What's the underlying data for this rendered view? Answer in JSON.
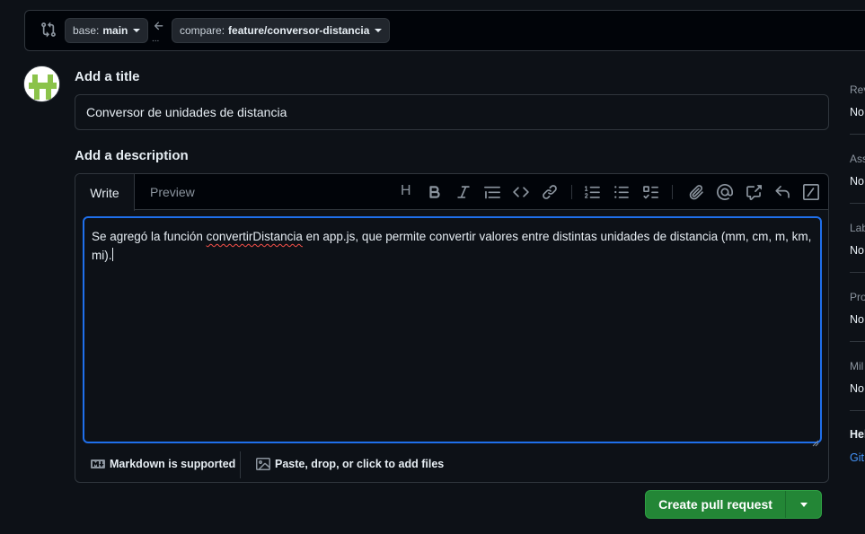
{
  "compare": {
    "base_label": "base:",
    "base_value": "main",
    "compare_label": "compare:",
    "compare_value": "feature/conversor-distancia",
    "arrow_dots": "..."
  },
  "form": {
    "title_label": "Add a title",
    "title_value": "Conversor de unidades de distancia",
    "description_label": "Add a description"
  },
  "editor": {
    "tabs": [
      "Write",
      "Preview"
    ],
    "heading_glyph": "H",
    "text_before": "Se agregó la función ",
    "text_misspelled": "convertirDistancia",
    "text_after": " en app.js, que permite convertir valores entre distintas unidades de distancia (mm, cm, m, km, mi).",
    "markdown_note": "Markdown is supported",
    "attach_note": "Paste, drop, or click to add files"
  },
  "actions": {
    "create_label": "Create pull request"
  },
  "sidebar": {
    "sections": [
      {
        "head": "Rev",
        "value": "No"
      },
      {
        "head": "Ass",
        "value": "No"
      },
      {
        "head": "Lab",
        "value": "No"
      },
      {
        "head": "Pro",
        "value": "No"
      },
      {
        "head": "Mil",
        "value": "No"
      }
    ],
    "help": "Hel",
    "help_link": "Git"
  },
  "colors": {
    "background": "#0d1117",
    "border": "#30363d",
    "accent_blue": "#1f6feb",
    "primary_green": "#238636",
    "link": "#4493f8"
  }
}
